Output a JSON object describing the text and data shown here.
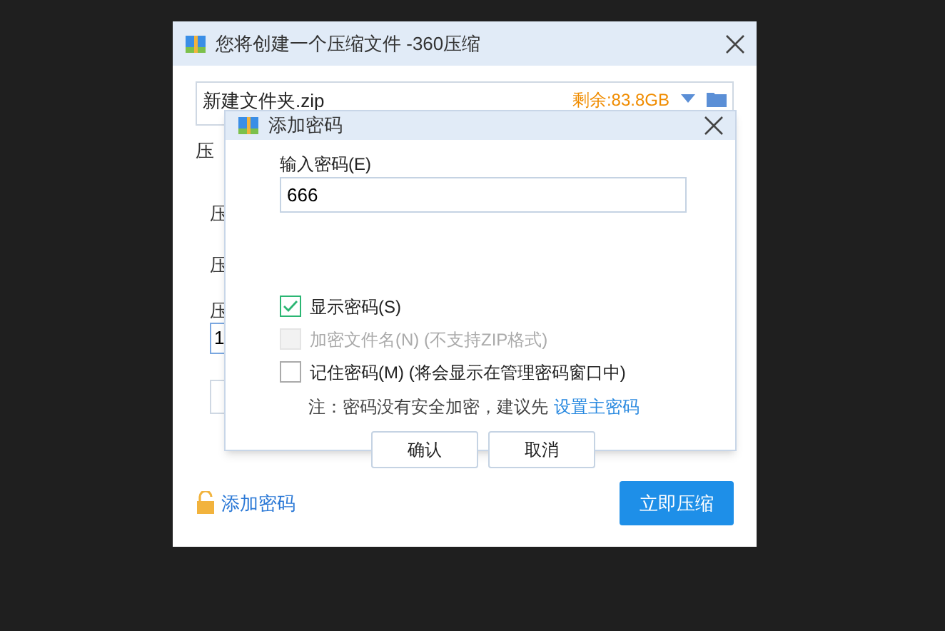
{
  "window": {
    "title": "您将创建一个压缩文件 -360压缩"
  },
  "path_field": {
    "value": "新建文件夹.zip",
    "free_space": "剩余:83.8GB"
  },
  "hidden_labels": [
    "压",
    "压",
    "压",
    "压"
  ],
  "hidden_field": {
    "value": "1"
  },
  "add_password_link": "添加密码",
  "compress_button": "立即压缩",
  "dialog": {
    "title": "添加密码",
    "password_label": "输入密码(E)",
    "password": {
      "value": "666"
    },
    "options": [
      {
        "label": "显示密码(S)",
        "checked": true,
        "disabled": false
      },
      {
        "label": "加密文件名(N) (不支持ZIP格式)",
        "checked": false,
        "disabled": true
      },
      {
        "label": "记住密码(M) (将会显示在管理密码窗口中)",
        "checked": false,
        "disabled": false
      }
    ],
    "note": "注：密码没有安全加密，建议先",
    "note_link": "设置主密码",
    "buttons": [
      "确认",
      "取消"
    ]
  }
}
